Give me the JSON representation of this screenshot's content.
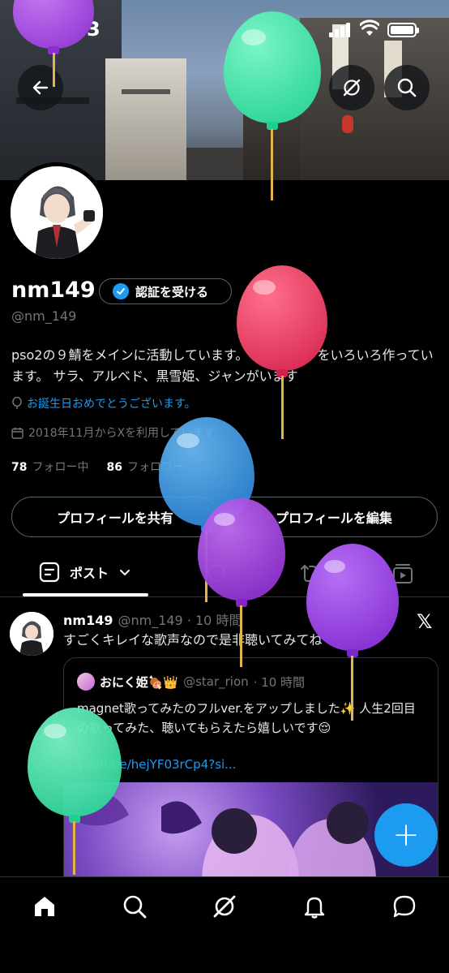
{
  "status_bar": {
    "time": "6:03"
  },
  "header": {
    "back_icon": "arrow-left-icon",
    "grok_icon": "grok-icon",
    "search_icon": "search-icon"
  },
  "profile": {
    "name": "nm149",
    "verify_label": "認証を受ける",
    "handle": "@nm_149",
    "bio": "pso2の９鯖をメインに活動しています。 再現キャラをいろいろ作っています。 サラ、アルベド、黒雪姫、ジャンがいます",
    "birthday": "お誕生日おめでとうございます。",
    "joined": "2018年11月からXを利用しています",
    "following_count": "78",
    "following_label": "フォロー中",
    "followers_count": "86",
    "followers_label": "フォロワー",
    "share_button": "プロフィールを共有",
    "edit_button": "プロフィールを編集"
  },
  "tabs": {
    "posts_label": "ポスト"
  },
  "tweet": {
    "name": "nm149",
    "handle": "@nm_149",
    "time": "· 10 時間",
    "text": "すごくキレイな歌声なので是非聴いてみてね",
    "quote": {
      "name": "おにく姫🍖👑",
      "handle": "@star_rion",
      "time": "· 10 時間",
      "text": "magnet歌ってみたのフルver.をアップしました✨ 人生2回目の歌ってみた、聴いてもらえたら嬉しいです😌",
      "link": "youtube/hejYF03rCp4?si..."
    }
  },
  "fab_label": "+",
  "colors": {
    "accent": "#1d9bf0",
    "balloon_green": "#2fe0a0",
    "balloon_red": "#e0305a",
    "balloon_blue": "#2f96e8",
    "balloon_purple": "#9a3fd6"
  }
}
